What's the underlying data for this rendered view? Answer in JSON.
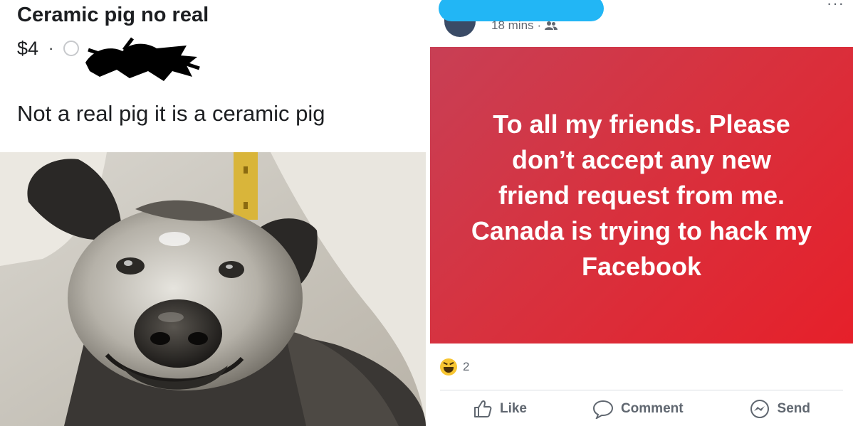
{
  "listing": {
    "title": "Ceramic pig no real",
    "price": "$4",
    "separator": "·",
    "description": "Not a real pig it is a ceramic pig"
  },
  "post": {
    "timestamp": "18 mins",
    "timestamp_separator": "·",
    "more_menu": "···",
    "status_text": "To all my friends. Please\ndon’t  accept any new\nfriend request from me.\nCanada is trying to hack my\nFacebook",
    "status_colors": {
      "start": "#c83f55",
      "end": "#e6202a"
    },
    "reaction_icon": "haha-emoji-icon",
    "reaction_count": "2",
    "actions": {
      "like": "Like",
      "comment": "Comment",
      "send": "Send"
    }
  },
  "colors": {
    "redaction_blue": "#22b6f5",
    "text_gray": "#606770",
    "text_dark": "#1c1e21"
  }
}
